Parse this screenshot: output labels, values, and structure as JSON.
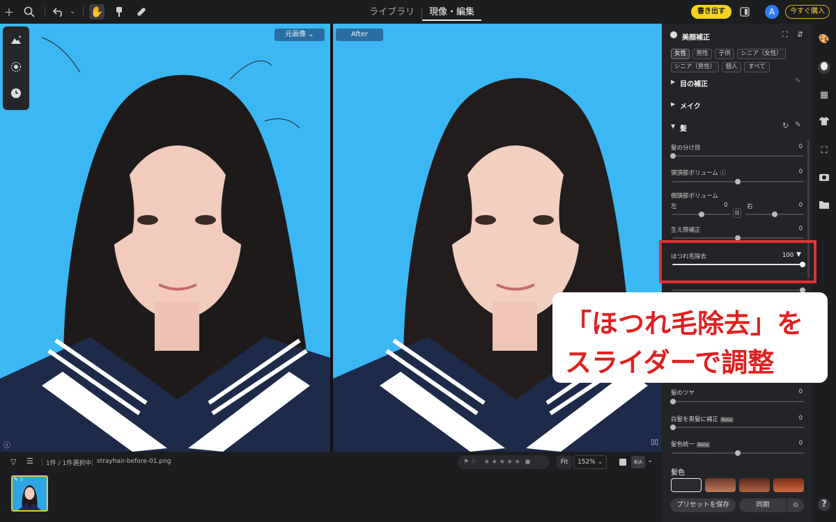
{
  "top_bar": {
    "tabs": [
      "ライブラリ",
      "現像・編集"
    ],
    "active_tab": "現像・編集",
    "export_label": "書き出す",
    "buy_label": "今すぐ購入",
    "avatar_initial": "A"
  },
  "canvas": {
    "before_label": "元画像",
    "after_label": "After"
  },
  "bottom_bar": {
    "selection_info": "1件 / 1件選択中",
    "filename": "strayhair-before-01.png",
    "fit_label": "Fit",
    "zoom": "152%",
    "ab_label": "B|A"
  },
  "right_panel": {
    "beauty_title": "美顔補正",
    "chips_row1": [
      "女性",
      "男性",
      "子供",
      "シニア（女性）"
    ],
    "chips_row2": [
      "シニア（男性）",
      "個人",
      "すべて"
    ],
    "selected_chip": "女性",
    "eye_section": "目の補正",
    "makeup_section": "メイク",
    "hair_section": "髪",
    "sliders": {
      "part": {
        "label": "髪の分け目",
        "value": "0"
      },
      "crown": {
        "label": "頭頂部ボリューム",
        "value": "0"
      },
      "side": {
        "label": "側頭部ボリューム",
        "left_label": "左",
        "left_value": "0",
        "right_label": "右",
        "right_value": "0"
      },
      "hairline": {
        "label": "生え際補正",
        "value": "0"
      },
      "stray": {
        "label": "ほつれ毛除去",
        "value": "100"
      },
      "shine": {
        "label": "髪のツヤ",
        "value": "0"
      },
      "gray": {
        "label": "白髪を黒髪に補正",
        "badge": "Beta",
        "value": "0"
      },
      "unify": {
        "label": "髪色統一",
        "badge": "Beta",
        "value": "0"
      }
    },
    "hair_color_title": "髪色",
    "save_preset_label": "プリセットを保存",
    "sync_label": "同期"
  },
  "callout": {
    "line1": "「ほつれ毛除去」を",
    "line2": "スライダーで調整"
  },
  "colors": {
    "accent_yellow": "#f5d31c",
    "highlight_red": "#e43232",
    "backdrop_blue": "#3bb8f4"
  }
}
